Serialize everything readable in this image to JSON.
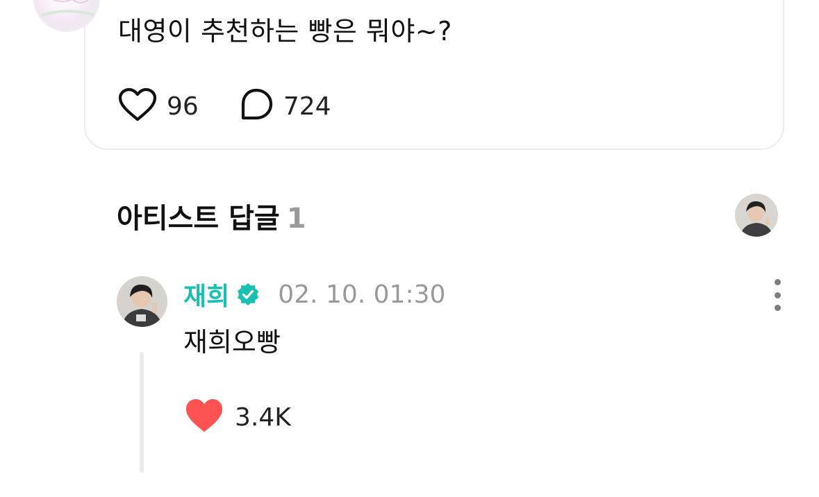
{
  "post": {
    "text": "대영이 추천하는 빵은 뭐야~?",
    "likes": "96",
    "comments": "724"
  },
  "artist_replies": {
    "title": "아티스트 답글",
    "count": "1"
  },
  "reply": {
    "name": "재희",
    "time": "02. 10. 01:30",
    "text": "재희오빵",
    "likes": "3.4K"
  },
  "icons": {
    "like_outline": "heart-outline-icon",
    "comment": "speech-bubble-icon",
    "verified": "verified-badge-icon",
    "more": "more-vertical-icon",
    "like_filled": "heart-filled-icon"
  },
  "colors": {
    "artist_name": "#19bfb1",
    "verified_badge": "#19bfb1",
    "liked_heart": "#ff5252",
    "muted_text": "#999999"
  }
}
